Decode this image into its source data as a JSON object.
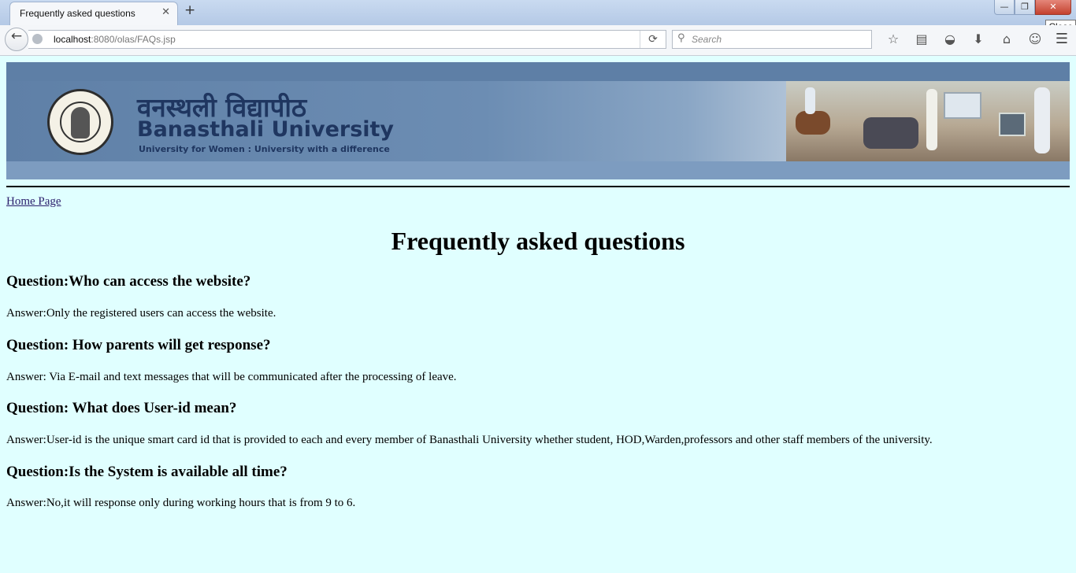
{
  "browser": {
    "tab_title": "Frequently asked questions",
    "tab_close": "✕",
    "new_tab": "+",
    "window_buttons": {
      "minimize": "—",
      "restore": "❐",
      "close": "✕"
    },
    "tooltip": "Close",
    "url_host": "localhost",
    "url_path": ":8080/olas/FAQs.jsp",
    "search_placeholder": "Search",
    "toolbar_icons": [
      "bookmark-star-icon",
      "reading-list-icon",
      "pocket-icon",
      "download-icon",
      "home-icon",
      "chat-icon"
    ]
  },
  "banner": {
    "hindi_name": "वनस्थली विद्यापीठ",
    "university_name": "Banasthali University",
    "tagline": "University for Women : University with a difference"
  },
  "page": {
    "home_link": "Home Page",
    "title": "Frequently asked questions",
    "faqs": [
      {
        "q": "Question:Who can access the website?",
        "a": "Answer:Only the registered users can access the website."
      },
      {
        "q": "Question: How parents will get response?",
        "a": "Answer: Via E-mail and text messages that will be communicated after the processing of leave."
      },
      {
        "q": "Question: What does User-id mean?",
        "a": "Answer:User-id is the unique smart card id that is provided to each and every member of Banasthali University whether student, HOD,Warden,professors and other staff members of the university."
      },
      {
        "q": "Question:Is the System is available all time?",
        "a": "Answer:No,it will response only during working hours that is from 9 to 6."
      }
    ]
  },
  "colors": {
    "page_background": "#e0ffff",
    "banner_blue": "#6d8fb4",
    "title_text": "#1f3660"
  }
}
